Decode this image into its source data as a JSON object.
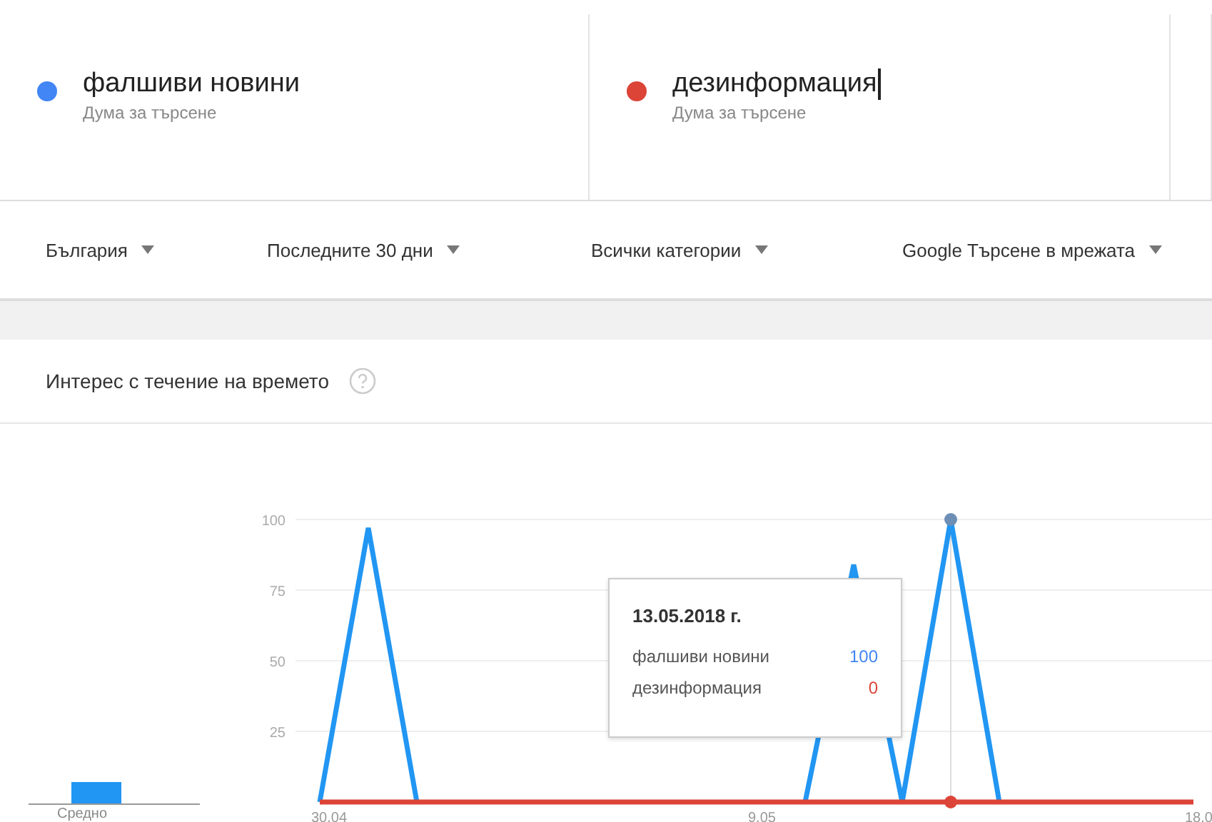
{
  "search_terms": [
    {
      "term": "фалшиви новини",
      "hint": "Дума за търсене",
      "color": "#4285f4",
      "focused": false
    },
    {
      "term": "дезинформация",
      "hint": "Дума за търсене",
      "color": "#db4437",
      "focused": true
    }
  ],
  "filters": [
    "България",
    "Последните 30 дни",
    "Всички категории",
    "Google Търсене в мрежата"
  ],
  "interest_card": {
    "title": "Интерес с течение на времето",
    "average_label": "Средно",
    "chart_data": {
      "type": "line",
      "categories": [
        "30.04",
        null,
        null,
        null,
        null,
        null,
        null,
        null,
        null,
        "9.05",
        null,
        null,
        null,
        null,
        null,
        null,
        null,
        null,
        "18.0"
      ],
      "ylim": [
        0,
        100
      ],
      "grid": true,
      "yticks": [
        25,
        50,
        75,
        100
      ],
      "series": [
        {
          "name": "фалшиви новини",
          "color": "#2196f3",
          "values": [
            0,
            97,
            0,
            null,
            null,
            null,
            null,
            null,
            null,
            null,
            0,
            84,
            0,
            100,
            0,
            null,
            null,
            null,
            null
          ]
        },
        {
          "name": "дезинформация",
          "color": "#db4437",
          "values": [
            0,
            0,
            0,
            0,
            0,
            0,
            0,
            0,
            0,
            0,
            0,
            0,
            0,
            0,
            0,
            0,
            0,
            0,
            0
          ]
        }
      ]
    },
    "tooltip": {
      "date": "13.05.2018 г.",
      "rows": [
        {
          "value": "100",
          "color": "#4285f4"
        },
        {
          "value": "0",
          "color": "#db4437"
        }
      ]
    }
  }
}
